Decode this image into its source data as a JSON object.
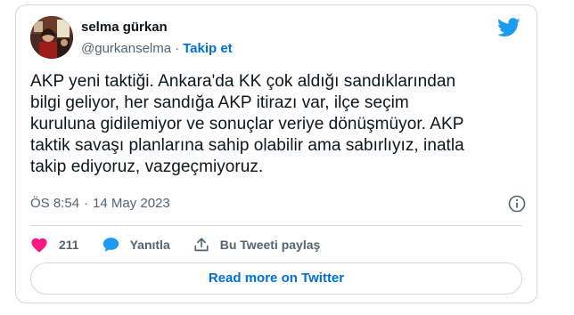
{
  "author": {
    "display_name": "selma gürkan",
    "handle": "@gurkanselma",
    "separator": "·",
    "follow_label": "Takip et"
  },
  "tweet": {
    "lines": [
      "AKP yeni taktiği. Ankara'da KK çok aldığı sandıklarından",
      "bilgi geliyor, her sandığa AKP itirazı var, ilçe seçim",
      "kuruluna gidilemiyor ve sonuçlar veriye dönüşmüyor. AKP",
      "taktik savaşı planlarına sahip olabilir ama sabırlıyız, inatla",
      "takip ediyoruz, vazgeçmiyoruz."
    ],
    "time": "ÖS 8:54",
    "date_separator": "·",
    "date": "14 May 2023"
  },
  "actions": {
    "like_count": "211",
    "reply_label": "Yanıtla",
    "share_label": "Bu Tweeti paylaş"
  },
  "read_more_label": "Read more on Twitter",
  "icons": {
    "brand": "twitter-bird-icon",
    "info": "info-icon",
    "like": "heart-icon",
    "reply": "speech-bubble-icon",
    "share": "share-upload-icon"
  },
  "colors": {
    "twitter_blue": "#1d9bf0",
    "link_blue": "#006fd6",
    "like_pink": "#f91880",
    "text_primary": "#0f1419",
    "text_secondary": "#536471",
    "border": "#cfd9de"
  }
}
